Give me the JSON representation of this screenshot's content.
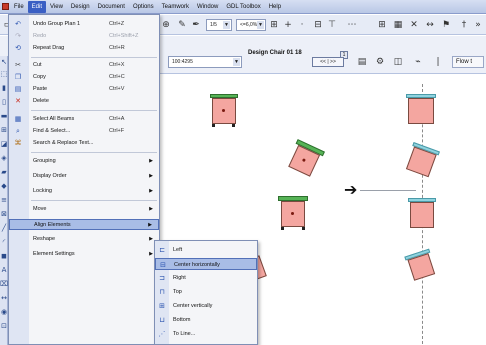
{
  "menubar": {
    "items": [
      {
        "label": "File"
      },
      {
        "label": "Edit"
      },
      {
        "label": "View"
      },
      {
        "label": "Design"
      },
      {
        "label": "Document"
      },
      {
        "label": "Options"
      },
      {
        "label": "Teamwork"
      },
      {
        "label": "Window"
      },
      {
        "label": "GDL Toolbox"
      },
      {
        "label": "Help"
      }
    ],
    "active_index": 1
  },
  "toolbar": {
    "zoom_combo": "1/5",
    "layer_combo": "<=6,0%",
    "view_combo": "100:4295",
    "design_chair_label": "Design Chair 01 18",
    "nav_box_label": "<< | >>",
    "nav_badge": "1",
    "flow_button_label": "Flow t"
  },
  "edit_menu": {
    "items": [
      {
        "label": "Undo Group Plan 1",
        "shortcut": "Ctrl+Z",
        "icon": "undo-icon",
        "glyph": "↶",
        "disabled": false
      },
      {
        "label": "Redo",
        "shortcut": "Ctrl+Shift+Z",
        "icon": "redo-icon",
        "glyph": "↷",
        "disabled": true
      },
      {
        "label": "Repeat Drag",
        "shortcut": "Ctrl+R",
        "icon": "repeat-icon",
        "glyph": "⟲",
        "disabled": false
      },
      {
        "label": "Cut",
        "shortcut": "Ctrl+X",
        "icon": "cut-icon",
        "glyph": "✂",
        "disabled": false
      },
      {
        "label": "Copy",
        "shortcut": "Ctrl+C",
        "icon": "copy-icon",
        "glyph": "❐",
        "disabled": false
      },
      {
        "label": "Paste",
        "shortcut": "Ctrl+V",
        "icon": "paste-icon",
        "glyph": "▤",
        "disabled": false
      },
      {
        "label": "Delete",
        "shortcut": "",
        "icon": "delete-icon",
        "glyph": "✕",
        "disabled": false
      },
      {
        "label": "Select All Beams",
        "shortcut": "Ctrl+A",
        "icon": "select-all-icon",
        "glyph": "▦",
        "disabled": false
      },
      {
        "label": "Find & Select...",
        "shortcut": "Ctrl+F",
        "icon": "find-select-icon",
        "glyph": "⌕",
        "disabled": false
      },
      {
        "label": "Search & Replace Text...",
        "shortcut": "",
        "icon": "search-replace-icon",
        "glyph": "⌘",
        "disabled": false
      },
      {
        "label": "Grouping",
        "shortcut": "",
        "icon": "",
        "glyph": "",
        "disabled": false,
        "submenu": true
      },
      {
        "label": "Display Order",
        "shortcut": "",
        "icon": "",
        "glyph": "",
        "disabled": false,
        "submenu": true
      },
      {
        "label": "Locking",
        "shortcut": "",
        "icon": "",
        "glyph": "",
        "disabled": false,
        "submenu": true
      },
      {
        "label": "Move",
        "shortcut": "",
        "icon": "",
        "glyph": "",
        "disabled": false,
        "submenu": true
      },
      {
        "label": "Align Elements",
        "shortcut": "",
        "icon": "",
        "glyph": "",
        "disabled": false,
        "submenu": true,
        "highlighted": true
      },
      {
        "label": "Reshape",
        "shortcut": "",
        "icon": "",
        "glyph": "",
        "disabled": false,
        "submenu": true
      },
      {
        "label": "Element Settings",
        "shortcut": "",
        "icon": "",
        "glyph": "",
        "disabled": false,
        "submenu": true
      }
    ]
  },
  "align_submenu": {
    "items": [
      {
        "label": "Left",
        "icon": "align-left-icon",
        "glyph": "⊏"
      },
      {
        "label": "Center horizontally",
        "icon": "align-center-horizontal-icon",
        "glyph": "⊟",
        "highlighted": true
      },
      {
        "label": "Right",
        "icon": "align-right-icon",
        "glyph": "⊐"
      },
      {
        "label": "Top",
        "icon": "align-top-icon",
        "glyph": "⊓"
      },
      {
        "label": "Center vertically",
        "icon": "align-center-vertical-icon",
        "glyph": "⊞"
      },
      {
        "label": "Bottom",
        "icon": "align-bottom-icon",
        "glyph": "⊔"
      },
      {
        "label": "To Line...",
        "icon": "align-to-line-icon",
        "glyph": "⋰"
      }
    ]
  },
  "canvas": {
    "arrow_glyph": "➔"
  },
  "colors": {
    "menu_highlight": "#a9bde6",
    "chair_seat": "#f4a6a0",
    "chair_back": "#56b356",
    "accent": "#3a5fc4"
  }
}
